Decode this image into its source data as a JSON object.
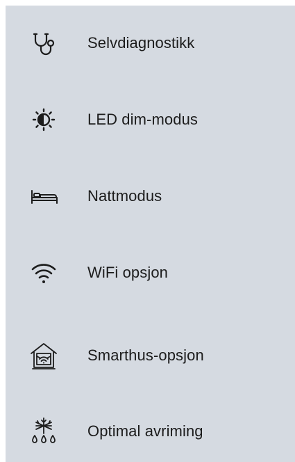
{
  "menu": {
    "items": [
      {
        "icon": "stethoscope-icon",
        "label": "Selvdiagnostikk"
      },
      {
        "icon": "brightness-dim-icon",
        "label": "LED dim-modus"
      },
      {
        "icon": "bed-icon",
        "label": "Nattmodus"
      },
      {
        "icon": "wifi-icon",
        "label": "WiFi opsjon"
      },
      {
        "icon": "smart-home-icon",
        "label": "Smarthus-opsjon"
      },
      {
        "icon": "defrost-icon",
        "label": "Optimal avriming"
      }
    ]
  },
  "colors": {
    "panel_background": "#d5dae1",
    "text": "#1c1c1c",
    "icon_stroke": "#1c1c1c"
  }
}
